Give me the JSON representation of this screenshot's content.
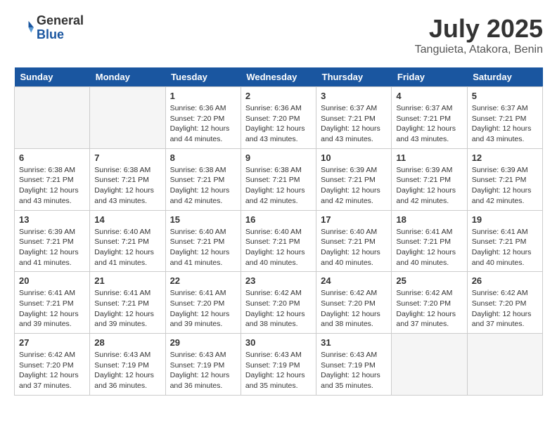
{
  "header": {
    "logo_general": "General",
    "logo_blue": "Blue",
    "month_year": "July 2025",
    "location": "Tanguieta, Atakora, Benin"
  },
  "days_of_week": [
    "Sunday",
    "Monday",
    "Tuesday",
    "Wednesday",
    "Thursday",
    "Friday",
    "Saturday"
  ],
  "weeks": [
    [
      {
        "day": null,
        "info": null
      },
      {
        "day": null,
        "info": null
      },
      {
        "day": "1",
        "info": "Sunrise: 6:36 AM\nSunset: 7:20 PM\nDaylight: 12 hours\nand 44 minutes."
      },
      {
        "day": "2",
        "info": "Sunrise: 6:36 AM\nSunset: 7:20 PM\nDaylight: 12 hours\nand 43 minutes."
      },
      {
        "day": "3",
        "info": "Sunrise: 6:37 AM\nSunset: 7:21 PM\nDaylight: 12 hours\nand 43 minutes."
      },
      {
        "day": "4",
        "info": "Sunrise: 6:37 AM\nSunset: 7:21 PM\nDaylight: 12 hours\nand 43 minutes."
      },
      {
        "day": "5",
        "info": "Sunrise: 6:37 AM\nSunset: 7:21 PM\nDaylight: 12 hours\nand 43 minutes."
      }
    ],
    [
      {
        "day": "6",
        "info": "Sunrise: 6:38 AM\nSunset: 7:21 PM\nDaylight: 12 hours\nand 43 minutes."
      },
      {
        "day": "7",
        "info": "Sunrise: 6:38 AM\nSunset: 7:21 PM\nDaylight: 12 hours\nand 43 minutes."
      },
      {
        "day": "8",
        "info": "Sunrise: 6:38 AM\nSunset: 7:21 PM\nDaylight: 12 hours\nand 42 minutes."
      },
      {
        "day": "9",
        "info": "Sunrise: 6:38 AM\nSunset: 7:21 PM\nDaylight: 12 hours\nand 42 minutes."
      },
      {
        "day": "10",
        "info": "Sunrise: 6:39 AM\nSunset: 7:21 PM\nDaylight: 12 hours\nand 42 minutes."
      },
      {
        "day": "11",
        "info": "Sunrise: 6:39 AM\nSunset: 7:21 PM\nDaylight: 12 hours\nand 42 minutes."
      },
      {
        "day": "12",
        "info": "Sunrise: 6:39 AM\nSunset: 7:21 PM\nDaylight: 12 hours\nand 42 minutes."
      }
    ],
    [
      {
        "day": "13",
        "info": "Sunrise: 6:39 AM\nSunset: 7:21 PM\nDaylight: 12 hours\nand 41 minutes."
      },
      {
        "day": "14",
        "info": "Sunrise: 6:40 AM\nSunset: 7:21 PM\nDaylight: 12 hours\nand 41 minutes."
      },
      {
        "day": "15",
        "info": "Sunrise: 6:40 AM\nSunset: 7:21 PM\nDaylight: 12 hours\nand 41 minutes."
      },
      {
        "day": "16",
        "info": "Sunrise: 6:40 AM\nSunset: 7:21 PM\nDaylight: 12 hours\nand 40 minutes."
      },
      {
        "day": "17",
        "info": "Sunrise: 6:40 AM\nSunset: 7:21 PM\nDaylight: 12 hours\nand 40 minutes."
      },
      {
        "day": "18",
        "info": "Sunrise: 6:41 AM\nSunset: 7:21 PM\nDaylight: 12 hours\nand 40 minutes."
      },
      {
        "day": "19",
        "info": "Sunrise: 6:41 AM\nSunset: 7:21 PM\nDaylight: 12 hours\nand 40 minutes."
      }
    ],
    [
      {
        "day": "20",
        "info": "Sunrise: 6:41 AM\nSunset: 7:21 PM\nDaylight: 12 hours\nand 39 minutes."
      },
      {
        "day": "21",
        "info": "Sunrise: 6:41 AM\nSunset: 7:21 PM\nDaylight: 12 hours\nand 39 minutes."
      },
      {
        "day": "22",
        "info": "Sunrise: 6:41 AM\nSunset: 7:20 PM\nDaylight: 12 hours\nand 39 minutes."
      },
      {
        "day": "23",
        "info": "Sunrise: 6:42 AM\nSunset: 7:20 PM\nDaylight: 12 hours\nand 38 minutes."
      },
      {
        "day": "24",
        "info": "Sunrise: 6:42 AM\nSunset: 7:20 PM\nDaylight: 12 hours\nand 38 minutes."
      },
      {
        "day": "25",
        "info": "Sunrise: 6:42 AM\nSunset: 7:20 PM\nDaylight: 12 hours\nand 37 minutes."
      },
      {
        "day": "26",
        "info": "Sunrise: 6:42 AM\nSunset: 7:20 PM\nDaylight: 12 hours\nand 37 minutes."
      }
    ],
    [
      {
        "day": "27",
        "info": "Sunrise: 6:42 AM\nSunset: 7:20 PM\nDaylight: 12 hours\nand 37 minutes."
      },
      {
        "day": "28",
        "info": "Sunrise: 6:43 AM\nSunset: 7:19 PM\nDaylight: 12 hours\nand 36 minutes."
      },
      {
        "day": "29",
        "info": "Sunrise: 6:43 AM\nSunset: 7:19 PM\nDaylight: 12 hours\nand 36 minutes."
      },
      {
        "day": "30",
        "info": "Sunrise: 6:43 AM\nSunset: 7:19 PM\nDaylight: 12 hours\nand 35 minutes."
      },
      {
        "day": "31",
        "info": "Sunrise: 6:43 AM\nSunset: 7:19 PM\nDaylight: 12 hours\nand 35 minutes."
      },
      {
        "day": null,
        "info": null
      },
      {
        "day": null,
        "info": null
      }
    ]
  ]
}
